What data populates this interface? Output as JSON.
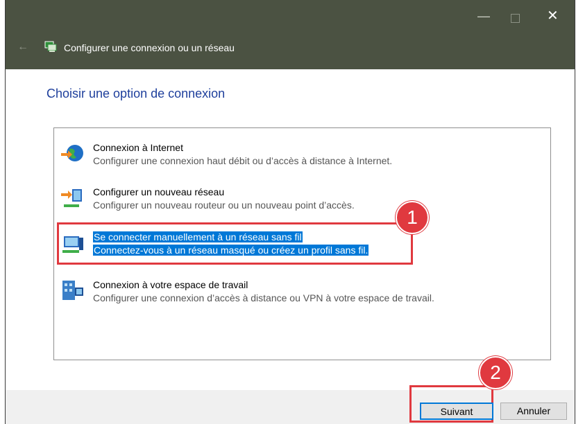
{
  "window": {
    "title": "Configurer une connexion ou un réseau",
    "controls": {
      "minimize": "—",
      "close": "✕"
    }
  },
  "heading": "Choisir une option de connexion",
  "options": [
    {
      "title": "Connexion à Internet",
      "description": "Configurer une connexion haut débit ou d’accès à distance à Internet.",
      "icon": "globe-internet-icon",
      "selected": false
    },
    {
      "title": "Configurer un nouveau réseau",
      "description": "Configurer un nouveau routeur ou un nouveau point d’accès.",
      "icon": "new-network-icon",
      "selected": false
    },
    {
      "title": "Se connecter manuellement à un réseau sans fil",
      "description": "Connectez-vous à un réseau masqué ou créez un profil sans fil.",
      "icon": "wireless-network-icon",
      "selected": true
    },
    {
      "title": "Connexion à votre espace de travail",
      "description": "Configurer une connexion d’accès à distance ou VPN à votre espace de travail.",
      "icon": "workplace-vpn-icon",
      "selected": false
    }
  ],
  "annotations": {
    "step1": "1",
    "step2": "2"
  },
  "buttons": {
    "next": "Suivant",
    "cancel": "Annuler"
  },
  "colors": {
    "titlebar": "#4b5242",
    "selection": "#0078d7",
    "annotation": "#e0393f",
    "heading": "#1e3f9c"
  }
}
